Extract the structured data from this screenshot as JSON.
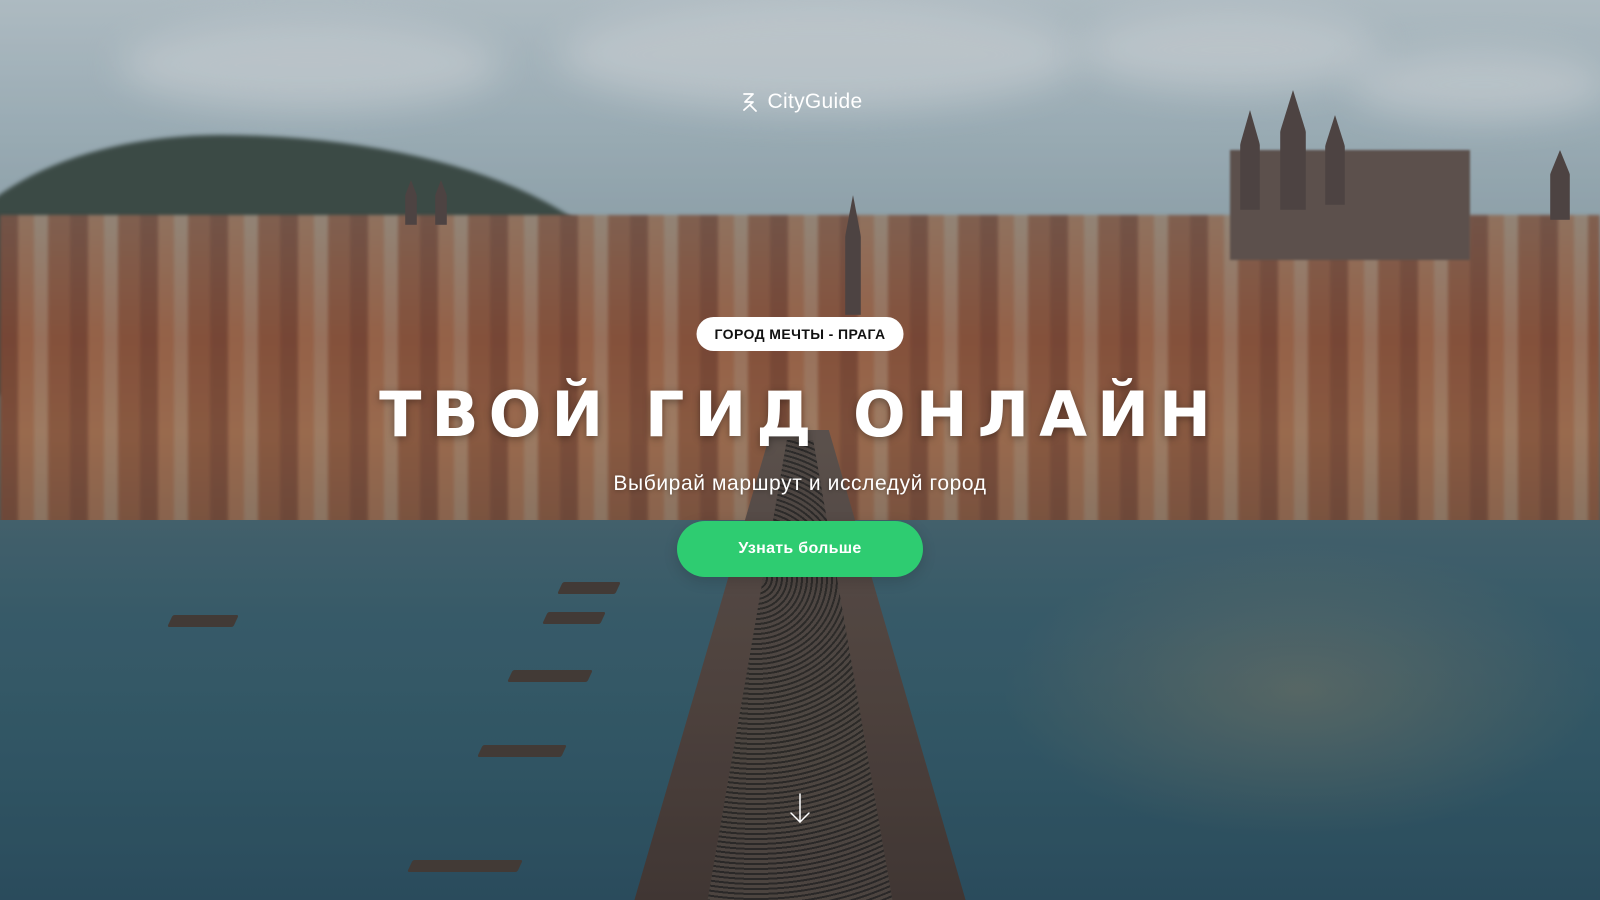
{
  "brand": {
    "name": "CityGuide",
    "icon": "cityguide-logo-icon"
  },
  "hero": {
    "tag": "ГОРОД МЕЧТЫ - ПРАГА",
    "headline": "ТВОЙ ГИД ОНЛАЙН",
    "subtitle": "Выбирай маршрут и исследуй город",
    "cta_label": "Узнать больше",
    "scroll_icon": "arrow-down-icon"
  },
  "colors": {
    "accent": "#2ecc71",
    "pill_bg": "#ffffff",
    "text": "#ffffff"
  }
}
